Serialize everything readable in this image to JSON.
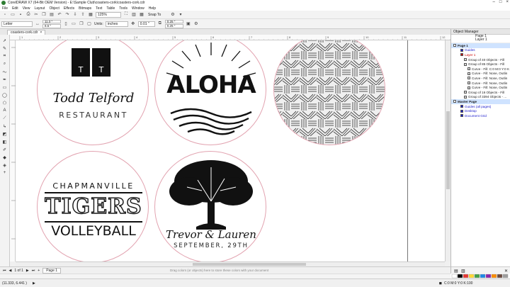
{
  "window": {
    "title": "CorelDRAW X7 (64-Bit OEM Version) - E:\\Sample Club\\coasters-cork\\coasters-cork.cdr"
  },
  "menu": [
    "File",
    "Edit",
    "View",
    "Layout",
    "Object",
    "Effects",
    "Bitmaps",
    "Text",
    "Table",
    "Tools",
    "Window",
    "Help"
  ],
  "toolbar": {
    "zoom": "125%",
    "snap_label": "Snap To"
  },
  "propbar": {
    "page_size": "Letter",
    "width": "11.0 \"",
    "height": "8.5 \"",
    "units_label": "Units:",
    "units_value": "inches",
    "nudge": "0.01 \"",
    "dup_x": "0.25 \"",
    "dup_y": "0.25 \""
  },
  "doc_tab": "coasters-cork.cdr",
  "coasters": {
    "todd": {
      "mark": "T",
      "line1": "Todd Telford",
      "line2": "RESTAURANT"
    },
    "aloha": {
      "word": "ALOHA"
    },
    "tigers": {
      "top": "CHAPMANVILLE",
      "mid": "TIGERS",
      "bottom": "VOLLEYBALL"
    },
    "wedding": {
      "names": "Trevor & Lauren",
      "date": "SEPTEMBER, 29TH"
    }
  },
  "pages": {
    "counter": "1 of 1",
    "tab": "Page 1"
  },
  "hint": "Drag colors (or objects) here to store these colors with your document",
  "status": {
    "coords": "(11.333, 6.441 )",
    "fill": "C:0 M:0 Y:0 K:100"
  },
  "object_manager": {
    "title": "Object Manager",
    "page": "Page 1",
    "layer": "Layer 1",
    "rows": [
      {
        "text": "Page 1",
        "indent": 0,
        "bold": true
      },
      {
        "text": "Guides",
        "indent": 2,
        "color": "#1a1acc"
      },
      {
        "text": "Layer 1",
        "indent": 2,
        "color": "#cc0000"
      },
      {
        "text": "Group of 40 Objects - Fill",
        "indent": 3
      },
      {
        "text": "Group of 85 Objects - Fill",
        "indent": 3
      },
      {
        "text": "Curve - Fill: C:0 M:0 Y:0 K",
        "indent": 4
      },
      {
        "text": "Curve - Fill: None, Outlin",
        "indent": 4
      },
      {
        "text": "Curve - Fill: None, Outlin",
        "indent": 4
      },
      {
        "text": "Curve - Fill: None, Outlin",
        "indent": 4
      },
      {
        "text": "Curve - Fill: None, Outlin",
        "indent": 4
      },
      {
        "text": "Group of 16 Objects - Fill",
        "indent": 3
      },
      {
        "text": "Group of 3394 Objects - ...",
        "indent": 3
      },
      {
        "text": "Master Page",
        "indent": 0,
        "bold": true
      },
      {
        "text": "Guides (all pages)",
        "indent": 2,
        "color": "#1a1acc"
      },
      {
        "text": "Desktop",
        "indent": 2,
        "color": "#1a1acc"
      },
      {
        "text": "Document Grid",
        "indent": 2,
        "color": "#1a1acc"
      }
    ]
  },
  "ruler": {
    "h": [
      "1",
      "2",
      "3",
      "4",
      "5",
      "6",
      "7",
      "8",
      "9",
      "10",
      "11",
      "12"
    ],
    "unit": "inches"
  },
  "colors": {
    "accent": "#e2a3b0",
    "ink": "#111111"
  }
}
